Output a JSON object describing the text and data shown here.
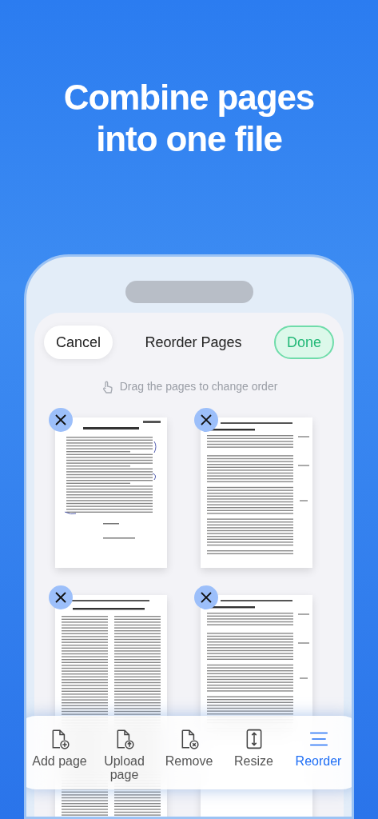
{
  "headline": "Combine pages into one file",
  "header": {
    "cancel": "Cancel",
    "title": "Reorder Pages",
    "done": "Done"
  },
  "hint": "Drag the pages to change order",
  "pages": [
    {
      "kind": "memo"
    },
    {
      "kind": "contract"
    },
    {
      "kind": "columns"
    },
    {
      "kind": "contract"
    }
  ],
  "toolbar": [
    {
      "label": "Add page",
      "kind": "add",
      "selected": false
    },
    {
      "label": "Upload page",
      "kind": "upload",
      "selected": false
    },
    {
      "label": "Remove",
      "kind": "remove",
      "selected": false
    },
    {
      "label": "Resize",
      "kind": "resize",
      "selected": false
    },
    {
      "label": "Reorder",
      "kind": "reorder",
      "selected": true
    }
  ]
}
